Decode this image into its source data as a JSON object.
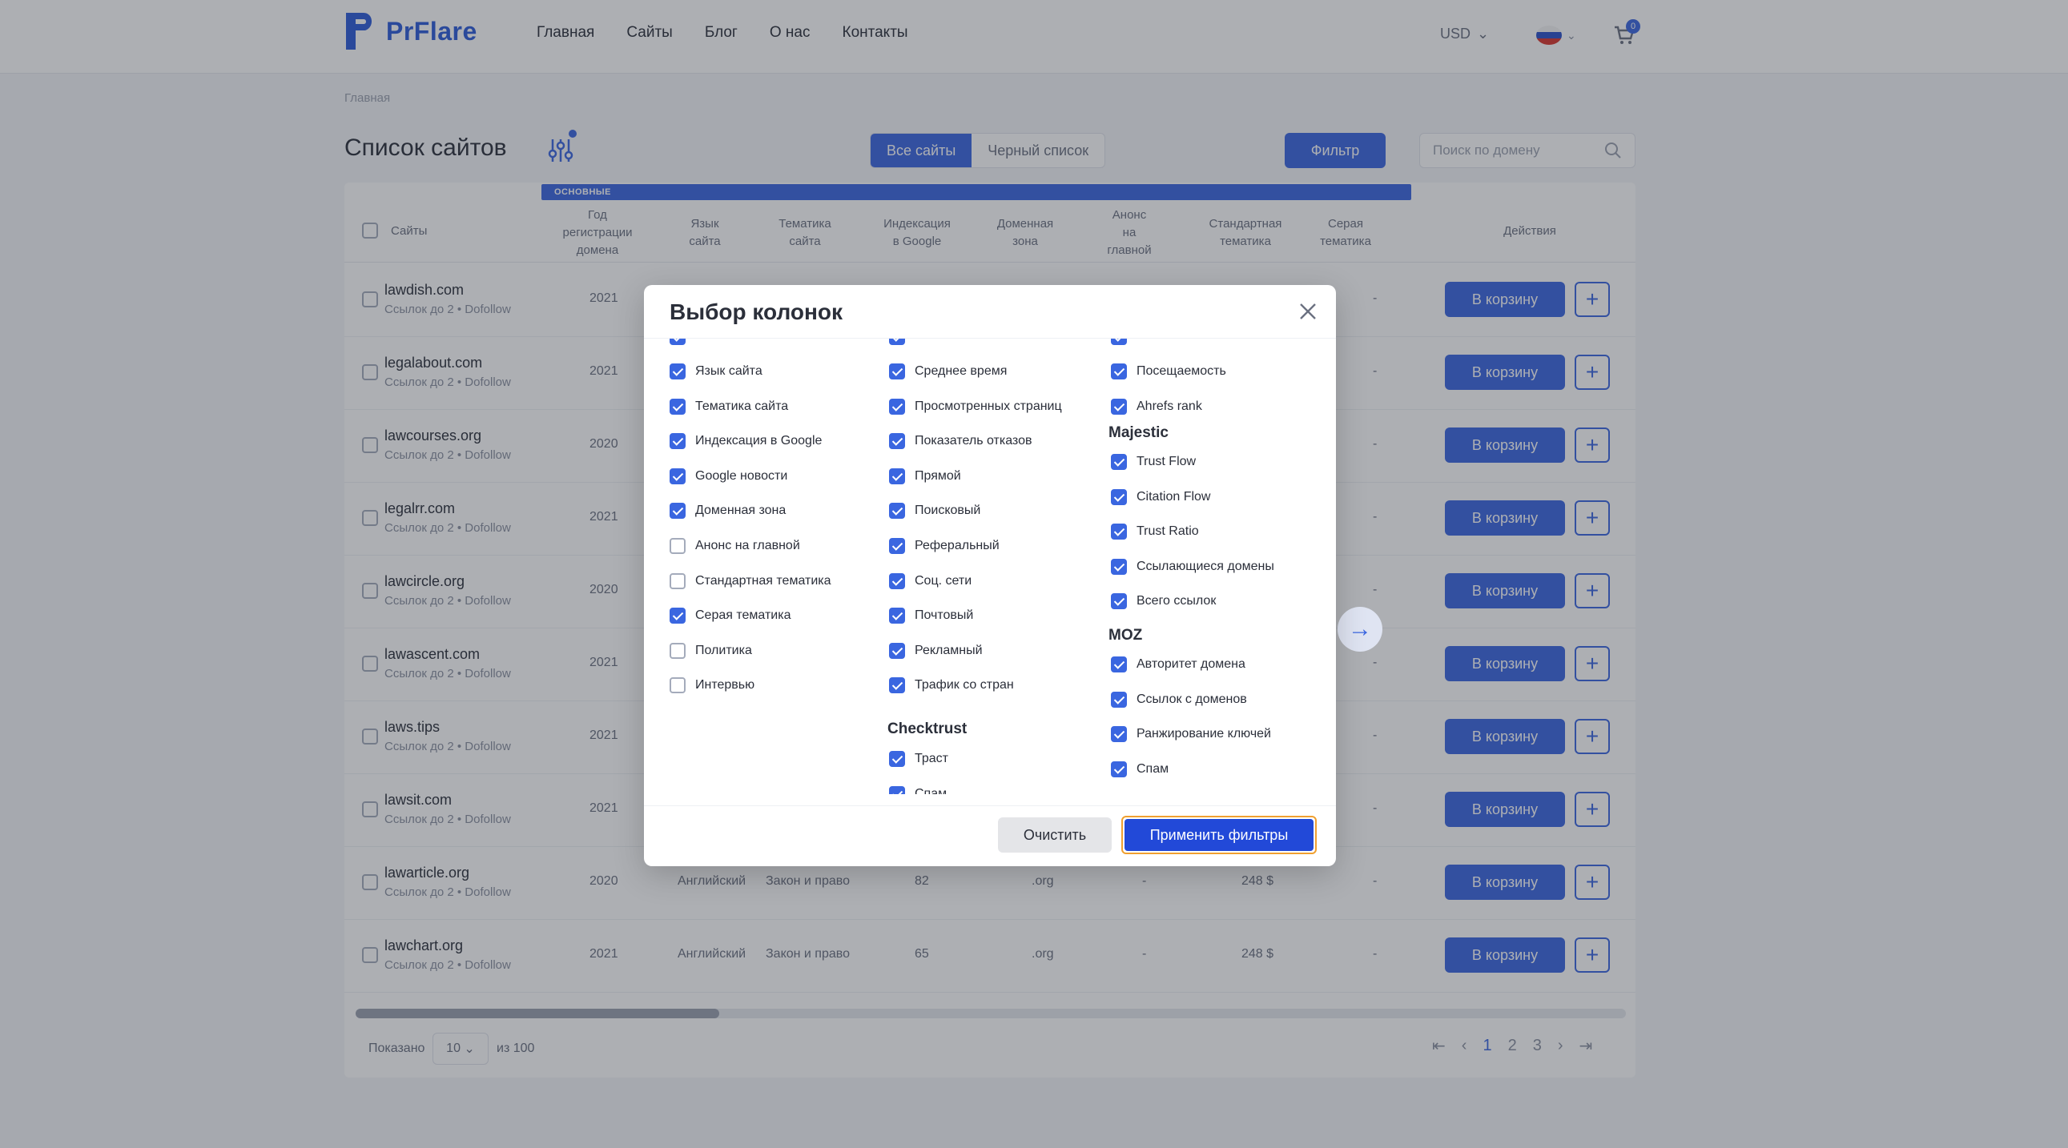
{
  "header": {
    "logo_text": "PrFlare",
    "nav": [
      "Главная",
      "Сайты",
      "Блог",
      "О нас",
      "Контакты"
    ],
    "currency": "USD",
    "cart_count": "0"
  },
  "breadcrumb": "Главная",
  "page": {
    "title": "Список сайтов",
    "tabs": [
      {
        "label": "Все сайты",
        "active": true
      },
      {
        "label": "Черный список",
        "active": false
      }
    ],
    "filter_label": "Фильтр",
    "search_placeholder": "Поиск по домену"
  },
  "table": {
    "group_label": "ОСНОВНЫЕ",
    "headers": {
      "sites": "Сайты",
      "reg_year": [
        "Год",
        "регистрации",
        "домена"
      ],
      "lang": [
        "Язык",
        "сайта"
      ],
      "topic": [
        "Тематика",
        "сайта"
      ],
      "google_index": [
        "Индексация",
        "в Google"
      ],
      "domain_zone": [
        "Доменная",
        "зона"
      ],
      "announce": [
        "Анонс",
        "на",
        "главной"
      ],
      "std_topic": [
        "Стандартная",
        "тематика"
      ],
      "gray_topic": [
        "Серая",
        "тематика"
      ],
      "actions": "Действия"
    },
    "cart_label": "В корзину",
    "plus_label": "+",
    "rows": [
      {
        "site": "lawdish.com",
        "sub": "Ссылок до 2 • Dofollow",
        "year": "2021",
        "lang": "",
        "topic": "",
        "index": "",
        "zone": "",
        "announce": "",
        "price": "",
        "gray": "-"
      },
      {
        "site": "legalabout.com",
        "sub": "Ссылок до 2 • Dofollow",
        "year": "2021",
        "lang": "",
        "topic": "",
        "index": "",
        "zone": "",
        "announce": "",
        "price": "",
        "gray": "-"
      },
      {
        "site": "lawcourses.org",
        "sub": "Ссылок до 2 • Dofollow",
        "year": "2020",
        "lang": "",
        "topic": "",
        "index": "",
        "zone": "",
        "announce": "",
        "price": "",
        "gray": "-"
      },
      {
        "site": "legalrr.com",
        "sub": "Ссылок до 2 • Dofollow",
        "year": "2021",
        "lang": "",
        "topic": "",
        "index": "",
        "zone": "",
        "announce": "",
        "price": "",
        "gray": "-"
      },
      {
        "site": "lawcircle.org",
        "sub": "Ссылок до 2 • Dofollow",
        "year": "2020",
        "lang": "",
        "topic": "",
        "index": "",
        "zone": "",
        "announce": "",
        "price": "",
        "gray": "-"
      },
      {
        "site": "lawascent.com",
        "sub": "Ссылок до 2 • Dofollow",
        "year": "2021",
        "lang": "",
        "topic": "",
        "index": "",
        "zone": "",
        "announce": "",
        "price": "",
        "gray": "-"
      },
      {
        "site": "laws.tips",
        "sub": "Ссылок до 2 • Dofollow",
        "year": "2021",
        "lang": "",
        "topic": "",
        "index": "",
        "zone": "",
        "announce": "",
        "price": "",
        "gray": "-"
      },
      {
        "site": "lawsit.com",
        "sub": "Ссылок до 2 • Dofollow",
        "year": "2021",
        "lang": "",
        "topic": "",
        "index": "",
        "zone": "",
        "announce": "",
        "price": "",
        "gray": "-"
      },
      {
        "site": "lawarticle.org",
        "sub": "Ссылок до 2 • Dofollow",
        "year": "2020",
        "lang": "Английский",
        "topic": "Закон и право",
        "index": "82",
        "zone": ".org",
        "announce": "-",
        "price": "248 $",
        "gray": "-"
      },
      {
        "site": "lawchart.org",
        "sub": "Ссылок до 2 • Dofollow",
        "year": "2021",
        "lang": "Английский",
        "topic": "Закон и право",
        "index": "65",
        "zone": ".org",
        "announce": "-",
        "price": "248 $",
        "gray": "-"
      }
    ],
    "pagination": {
      "shown_label": "Показано",
      "per_page": "10",
      "of_label": "из 100",
      "pages": [
        "1",
        "2",
        "3"
      ],
      "current": "1"
    }
  },
  "modal": {
    "title": "Выбор колонок",
    "col1": [
      {
        "label": "Язык сайта",
        "checked": true
      },
      {
        "label": "Тематика сайта",
        "checked": true
      },
      {
        "label": "Индексация в Google",
        "checked": true
      },
      {
        "label": "Google новости",
        "checked": true
      },
      {
        "label": "Доменная зона",
        "checked": true
      },
      {
        "label": "Анонс на главной",
        "checked": false
      },
      {
        "label": "Стандартная тематика",
        "checked": false
      },
      {
        "label": "Серая тематика",
        "checked": true
      },
      {
        "label": "Политика",
        "checked": false
      },
      {
        "label": "Интервью",
        "checked": false
      }
    ],
    "col2": [
      {
        "label": "Среднее время",
        "checked": true
      },
      {
        "label": "Просмотренных страниц",
        "checked": true
      },
      {
        "label": "Показатель отказов",
        "checked": true
      },
      {
        "label": "Прямой",
        "checked": true
      },
      {
        "label": "Поисковый",
        "checked": true
      },
      {
        "label": "Реферальный",
        "checked": true
      },
      {
        "label": "Соц. сети",
        "checked": true
      },
      {
        "label": "Почтовый",
        "checked": true
      },
      {
        "label": "Рекламный",
        "checked": true
      },
      {
        "label": "Трафик со стран",
        "checked": true
      }
    ],
    "col2_group": "Checktrust",
    "col2_group_items": [
      {
        "label": "Траст",
        "checked": true
      },
      {
        "label": "Спам",
        "checked": true
      }
    ],
    "col3": [
      {
        "label": "Посещаемость",
        "checked": true
      },
      {
        "label": "Ahrefs rank",
        "checked": true
      }
    ],
    "col3_group1": "Majestic",
    "col3_group1_items": [
      {
        "label": "Trust Flow",
        "checked": true
      },
      {
        "label": "Citation Flow",
        "checked": true
      },
      {
        "label": "Trust Ratio",
        "checked": true
      },
      {
        "label": "Ссылающиеся домены",
        "checked": true
      },
      {
        "label": "Всего ссылок",
        "checked": true
      }
    ],
    "col3_group2": "MOZ",
    "col3_group2_items": [
      {
        "label": "Авторитет домена",
        "checked": true
      },
      {
        "label": "Ссылок с доменов",
        "checked": true
      },
      {
        "label": "Ранжирование ключей",
        "checked": true
      },
      {
        "label": "Спам",
        "checked": true
      }
    ],
    "clear_label": "Очистить",
    "apply_label": "Применить фильтры"
  }
}
